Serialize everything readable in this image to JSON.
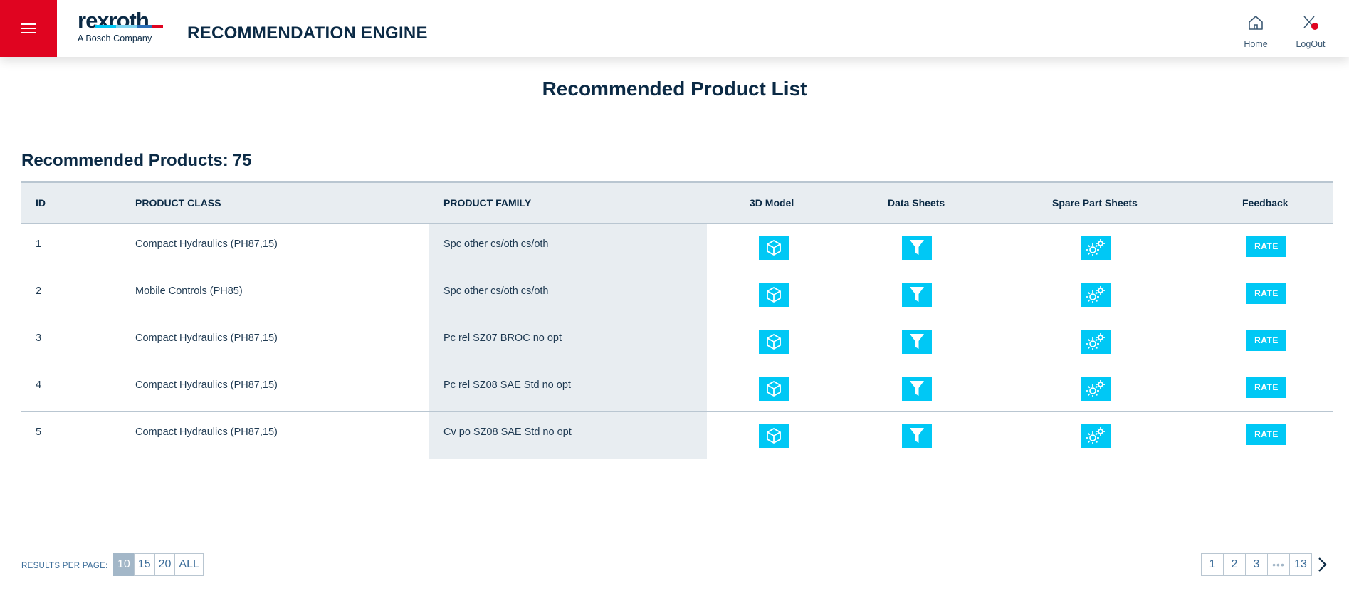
{
  "header": {
    "logo_word": "rexroth",
    "logo_sub": "A Bosch Company",
    "app_title": "RECOMMENDATION ENGINE",
    "nav": [
      {
        "label": "Home",
        "icon": "home-icon"
      },
      {
        "label": "LogOut",
        "icon": "logout-icon"
      }
    ],
    "colors": {
      "brand_red": "#e00420",
      "accent": "#00c8f5",
      "navy": "#0b2a45"
    }
  },
  "main": {
    "page_title": "Recommended Product List",
    "count_label": "Recommended Products:",
    "count_value": "75",
    "columns": [
      "ID",
      "PRODUCT CLASS",
      "PRODUCT FAMILY",
      "3D Model",
      "Data Sheets",
      "Spare Part Sheets",
      "Feedback"
    ],
    "rows": [
      {
        "id": "1",
        "product_class": "Compact Hydraulics (PH87,15)",
        "product_family": "Spc other cs/oth cs/oth",
        "rate": "RATE"
      },
      {
        "id": "2",
        "product_class": "Mobile Controls (PH85)",
        "product_family": "Spc other cs/oth cs/oth",
        "rate": "RATE"
      },
      {
        "id": "3",
        "product_class": "Compact Hydraulics (PH87,15)",
        "product_family": "Pc rel SZ07 BROC no opt",
        "rate": "RATE"
      },
      {
        "id": "4",
        "product_class": "Compact Hydraulics (PH87,15)",
        "product_family": "Pc rel SZ08 SAE Std no opt",
        "rate": "RATE"
      },
      {
        "id": "5",
        "product_class": "Compact Hydraulics (PH87,15)",
        "product_family": "Cv po SZ08 SAE Std no opt",
        "rate": "RATE"
      }
    ]
  },
  "footer": {
    "results_per_page_label": "RESULTS PER PAGE:",
    "results_per_page_options": [
      "10",
      "15",
      "20",
      "ALL"
    ],
    "results_per_page_selected": "10",
    "pages": [
      "1",
      "2",
      "3",
      "•••",
      "13"
    ]
  }
}
